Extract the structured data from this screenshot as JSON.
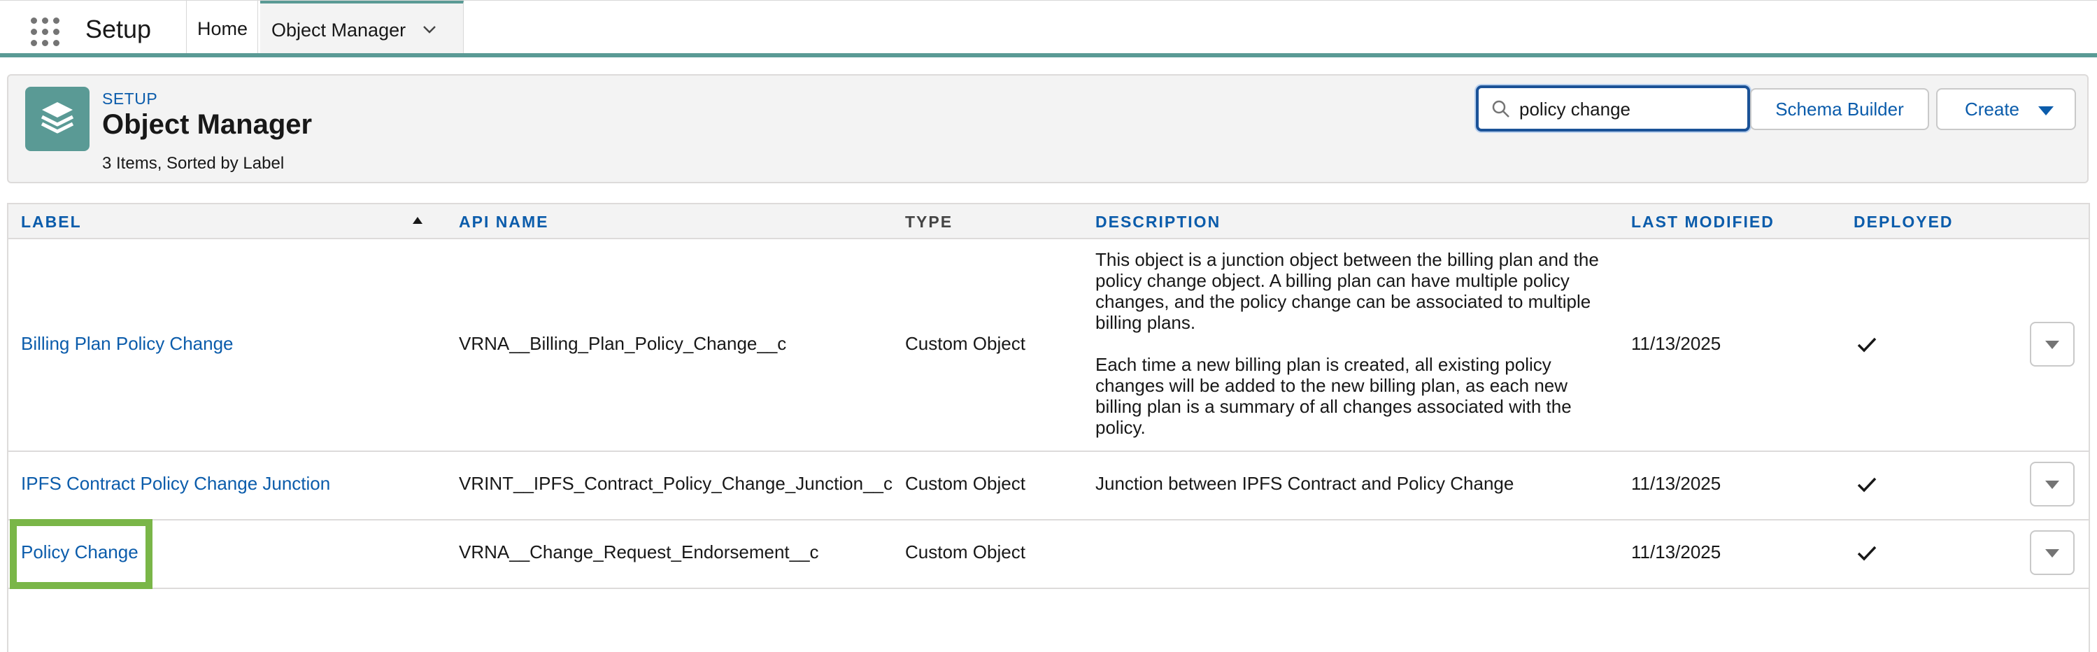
{
  "topbar": {
    "app_name": "Setup",
    "tabs": [
      {
        "label": "Home"
      },
      {
        "label": "Object Manager"
      }
    ]
  },
  "header": {
    "eyebrow": "SETUP",
    "title": "Object Manager",
    "subtitle": "3 Items, Sorted by Label",
    "search": {
      "value": "policy change",
      "icon": "search-icon"
    },
    "buttons": {
      "schema_builder": "Schema Builder",
      "create": "Create"
    }
  },
  "table": {
    "columns": [
      "LABEL",
      "API NAME",
      "TYPE",
      "DESCRIPTION",
      "LAST MODIFIED",
      "DEPLOYED"
    ],
    "sorted_by": "LABEL",
    "rows": [
      {
        "label": "Billing Plan Policy Change",
        "api_name": "VRNA__Billing_Plan_Policy_Change__c",
        "type": "Custom Object",
        "description": [
          "This object is a junction object between the billing plan and the policy change object. A billing plan can have multiple policy changes, and the policy change can be associated to multiple billing plans.",
          "Each time a new billing plan is created, all existing policy changes will be added to the new billing plan, as each new billing plan is a summary of all changes associated with the policy."
        ],
        "last_modified": "11/13/2025",
        "deployed": true
      },
      {
        "label": "IPFS Contract Policy Change Junction",
        "api_name": "VRINT__IPFS_Contract_Policy_Change_Junction__c",
        "type": "Custom Object",
        "description": [
          "Junction between IPFS Contract and Policy Change"
        ],
        "last_modified": "11/13/2025",
        "deployed": true
      },
      {
        "label": "Policy Change",
        "api_name": "VRNA__Change_Request_Endorsement__c",
        "type": "Custom Object",
        "description": [],
        "last_modified": "11/13/2025",
        "deployed": true
      }
    ]
  },
  "colors": {
    "brand": "#5a9a95",
    "link": "#0b5cab",
    "highlight": "#7ab648"
  }
}
